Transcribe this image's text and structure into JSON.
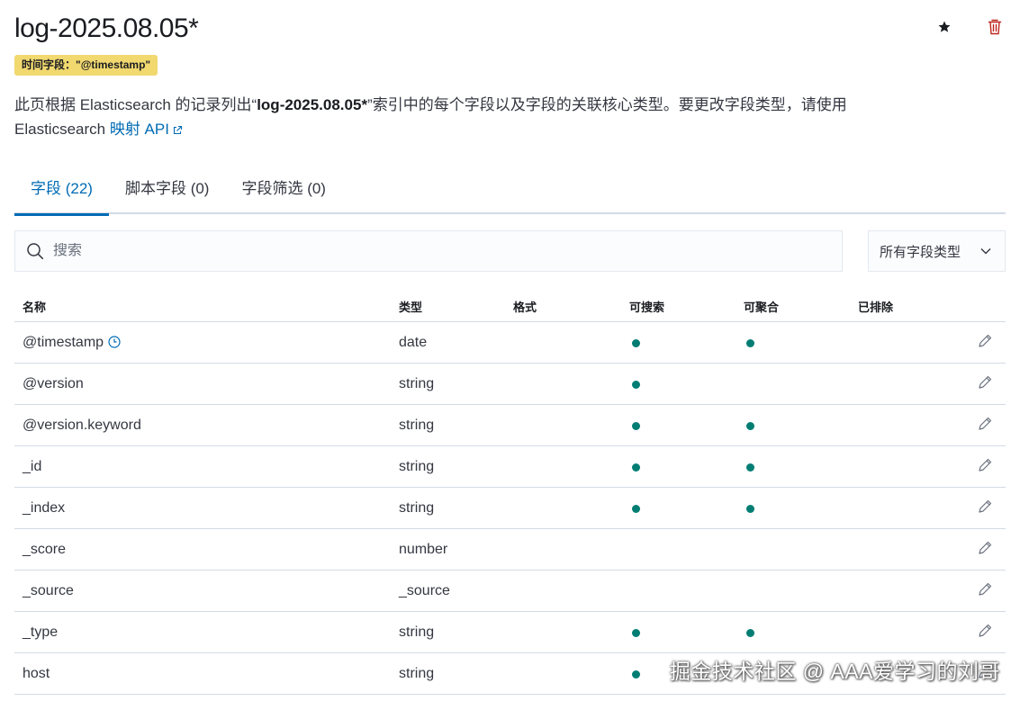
{
  "header": {
    "title": "log-2025.08.05*",
    "favorite_icon": "star-icon",
    "delete_icon": "trash-icon"
  },
  "time_badge": "时间字段：\"@timestamp\"",
  "description": {
    "before": "此页根据 Elasticsearch 的记录列出“",
    "index_name": "log-2025.08.05*",
    "after": "”索引中的每个字段以及字段的关联核心类型。要更改字段类型，请使用 Elasticsearch ",
    "link_label": "映射 API"
  },
  "tabs": [
    {
      "label": "字段 (22)",
      "active": true
    },
    {
      "label": "脚本字段 (0)",
      "active": false
    },
    {
      "label": "字段筛选 (0)",
      "active": false
    }
  ],
  "search": {
    "placeholder": "搜索",
    "value": ""
  },
  "type_filter": {
    "selected": "所有字段类型"
  },
  "columns": {
    "name": "名称",
    "type": "类型",
    "format": "格式",
    "searchable": "可搜索",
    "aggregatable": "可聚合",
    "excluded": "已排除"
  },
  "rows": [
    {
      "name": "@timestamp",
      "type": "date",
      "searchable": true,
      "aggregatable": true,
      "time_field": true
    },
    {
      "name": "@version",
      "type": "string",
      "searchable": true,
      "aggregatable": false
    },
    {
      "name": "@version.keyword",
      "type": "string",
      "searchable": true,
      "aggregatable": true
    },
    {
      "name": "_id",
      "type": "string",
      "searchable": true,
      "aggregatable": true
    },
    {
      "name": "_index",
      "type": "string",
      "searchable": true,
      "aggregatable": true
    },
    {
      "name": "_score",
      "type": "number",
      "searchable": false,
      "aggregatable": false
    },
    {
      "name": "_source",
      "type": "_source",
      "searchable": false,
      "aggregatable": false
    },
    {
      "name": "_type",
      "type": "string",
      "searchable": true,
      "aggregatable": true
    },
    {
      "name": "host",
      "type": "string",
      "searchable": true,
      "aggregatable": false
    }
  ],
  "watermark": "掘金技术社区 @ AAA爱学习的刘哥",
  "colors": {
    "accent": "#006bb4",
    "dot": "#017d73",
    "badge": "#f1d86f",
    "delete": "#bd271e"
  }
}
